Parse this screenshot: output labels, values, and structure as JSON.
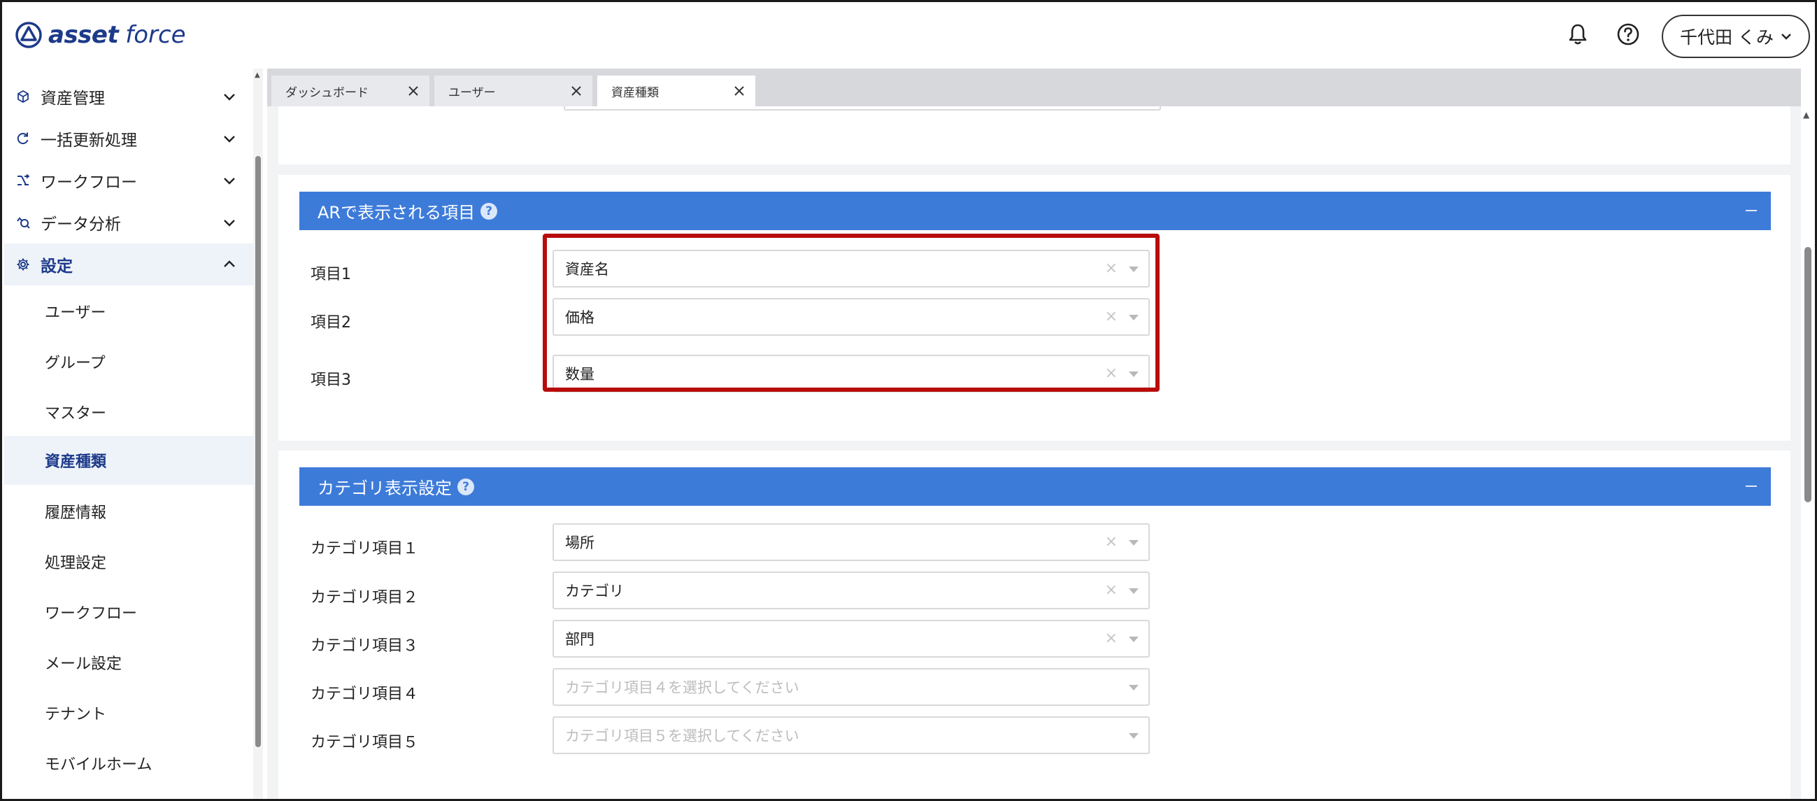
{
  "app": {
    "logo_main": "asset",
    "logo_sub": "force"
  },
  "header": {
    "user_name": "千代田 くみ",
    "icons": [
      "bell-icon",
      "help-circle-icon"
    ]
  },
  "sidebar": {
    "top_items": [
      {
        "label": "資産管理",
        "icon": "cube-icon"
      },
      {
        "label": "一括更新処理",
        "icon": "refresh-icon"
      },
      {
        "label": "ワークフロー",
        "icon": "workflow-icon"
      },
      {
        "label": "データ分析",
        "icon": "analytics-icon"
      },
      {
        "label": "設定",
        "icon": "gear-icon"
      }
    ],
    "sub_items": [
      {
        "label": "ユーザー"
      },
      {
        "label": "グループ"
      },
      {
        "label": "マスター"
      },
      {
        "label": "資産種類"
      },
      {
        "label": "履歴情報"
      },
      {
        "label": "処理設定"
      },
      {
        "label": "ワークフロー"
      },
      {
        "label": "メール設定"
      },
      {
        "label": "テナント"
      },
      {
        "label": "モバイルホーム"
      }
    ],
    "selected_sub_item": "資産種類"
  },
  "tabs": [
    {
      "label": "ダッシュボード",
      "active": false
    },
    {
      "label": "ユーザー",
      "active": false
    },
    {
      "label": "資産種類",
      "active": true
    }
  ],
  "ar_section": {
    "title": "ARで表示される項目",
    "fields": [
      {
        "label": "項目1",
        "value": "資産名"
      },
      {
        "label": "項目2",
        "value": "価格"
      },
      {
        "label": "項目3",
        "value": "数量"
      }
    ]
  },
  "category_section": {
    "title": "カテゴリ表示設定",
    "fields": [
      {
        "label": "カテゴリ項目１",
        "value": "場所",
        "placeholder": ""
      },
      {
        "label": "カテゴリ項目２",
        "value": "カテゴリ",
        "placeholder": ""
      },
      {
        "label": "カテゴリ項目３",
        "value": "部門",
        "placeholder": ""
      },
      {
        "label": "カテゴリ項目４",
        "value": "",
        "placeholder": "カテゴリ項目４を選択してください"
      },
      {
        "label": "カテゴリ項目５",
        "value": "",
        "placeholder": "カテゴリ項目５を選択してください"
      }
    ]
  },
  "colors": {
    "brand": "#1d3a8a",
    "section_header": "#3d7bd9",
    "highlight": "#b80c0c"
  }
}
